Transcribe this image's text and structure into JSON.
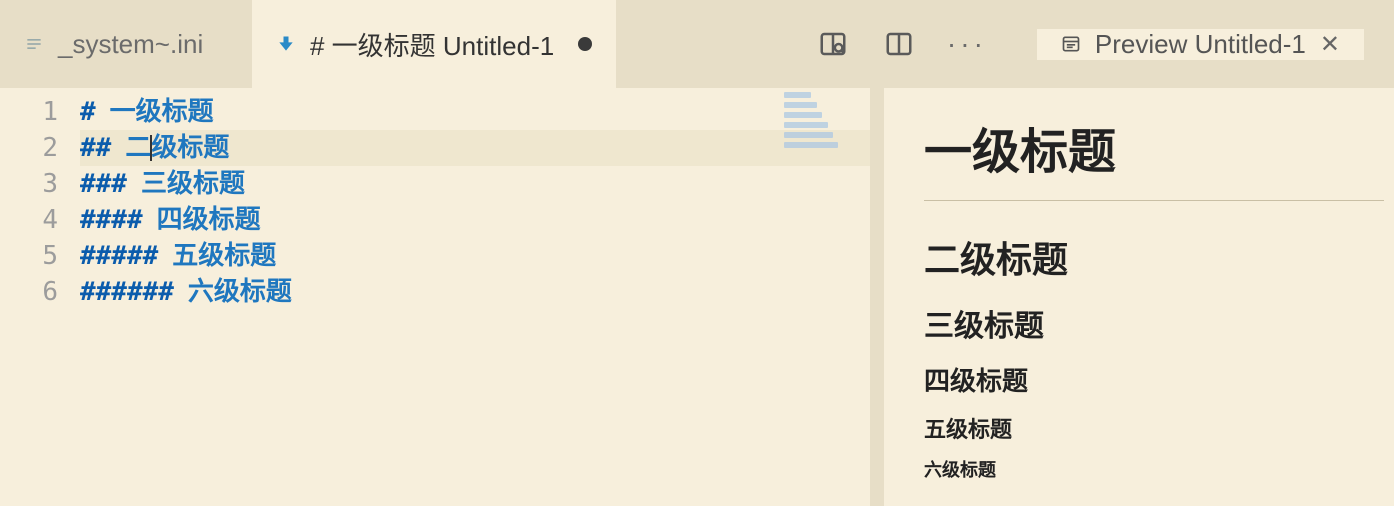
{
  "tabs": {
    "inactive": {
      "label": "_system~.ini"
    },
    "active": {
      "label": "# 一级标题  Untitled-1"
    }
  },
  "toolbar": {
    "preview_tab_label": "Preview Untitled-1"
  },
  "editor": {
    "lines": [
      {
        "num": "1",
        "mark": "#",
        "text": "一级标题"
      },
      {
        "num": "2",
        "mark": "##",
        "text": "二级标题",
        "cursor": true
      },
      {
        "num": "3",
        "mark": "###",
        "text": "三级标题"
      },
      {
        "num": "4",
        "mark": "####",
        "text": "四级标题"
      },
      {
        "num": "5",
        "mark": "#####",
        "text": "五级标题"
      },
      {
        "num": "6",
        "mark": "######",
        "text": "六级标题"
      }
    ]
  },
  "preview": {
    "h1": "一级标题",
    "h2": "二级标题",
    "h3": "三级标题",
    "h4": "四级标题",
    "h5": "五级标题",
    "h6": "六级标题"
  }
}
